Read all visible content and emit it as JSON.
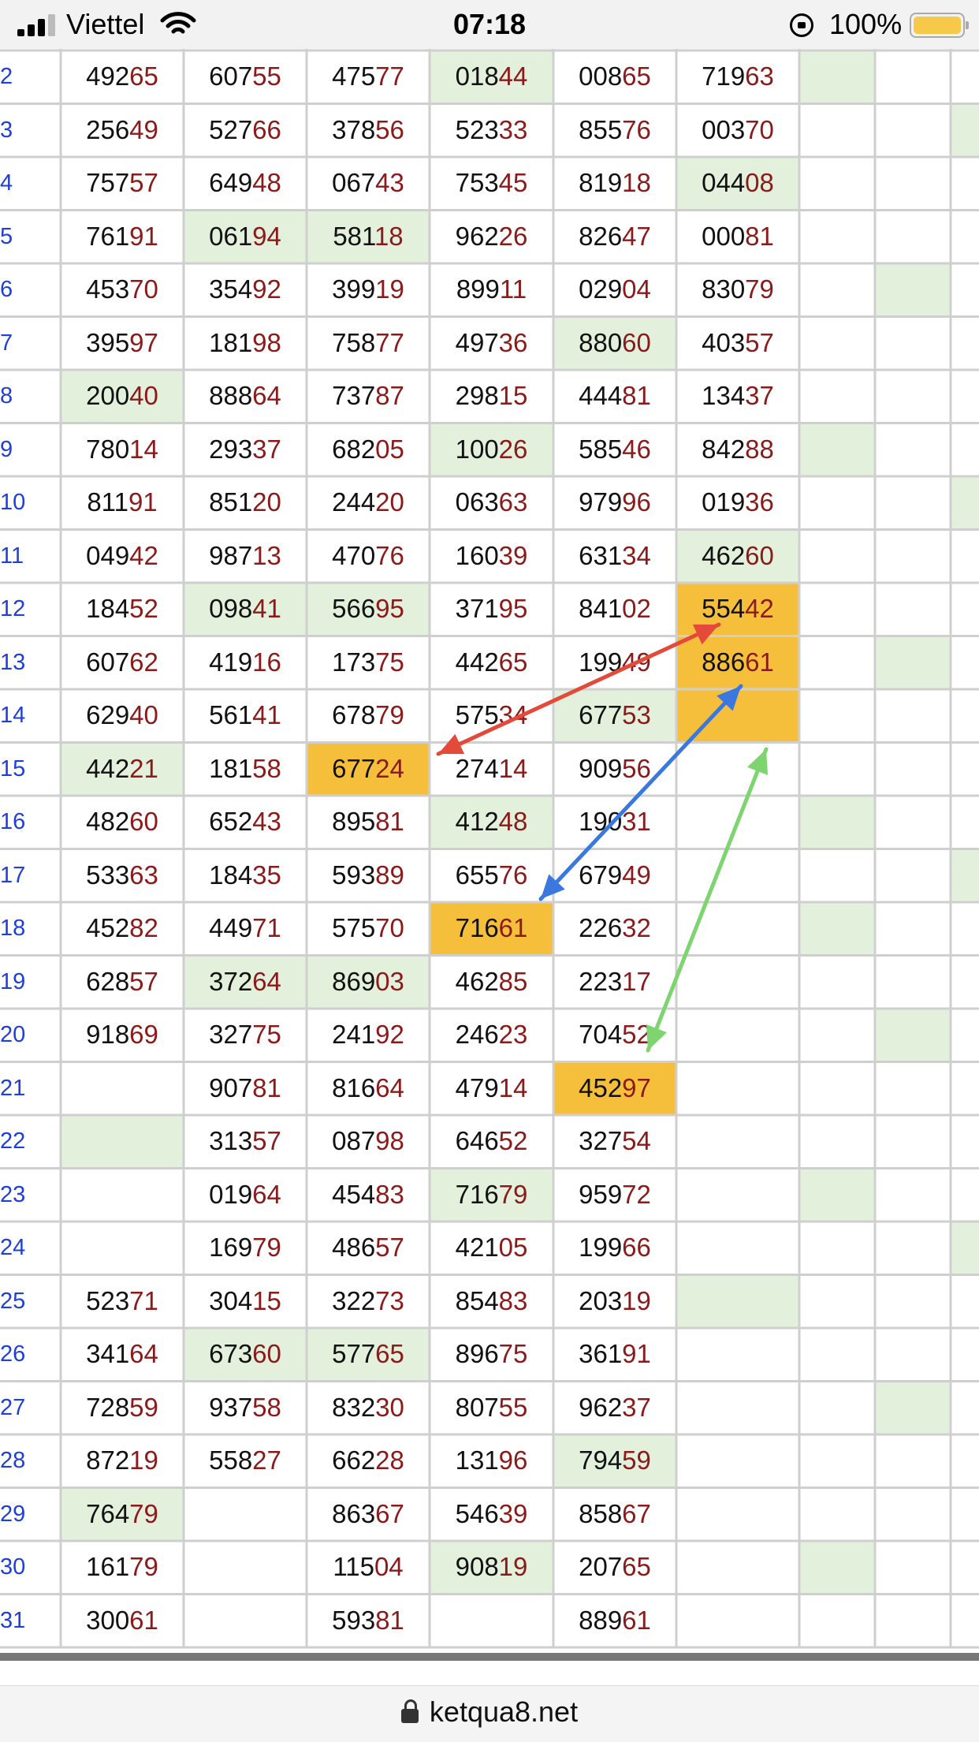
{
  "status_bar": {
    "carrier": "Viettel",
    "time": "07:18",
    "battery": "100%"
  },
  "colors": {
    "highlight": "#f6bf3b",
    "shade": "#e3f0dc",
    "row_label": "#1f3fd6",
    "tail_digits": "#8b1a1a",
    "arrow_red": "#e44a3a",
    "arrow_blue": "#3a78e0",
    "arrow_green": "#7ed46f"
  },
  "address_bar": {
    "domain": "ketqua8.net"
  },
  "table": {
    "rows": [
      {
        "label": "2",
        "values": [
          "49265",
          "60755",
          "47577",
          "01844",
          "00865",
          "71963"
        ]
      },
      {
        "label": "3",
        "values": [
          "25649",
          "52766",
          "37856",
          "52333",
          "85576",
          "00370"
        ]
      },
      {
        "label": "4",
        "values": [
          "75757",
          "64948",
          "06743",
          "75345",
          "81918",
          "04408"
        ]
      },
      {
        "label": "5",
        "values": [
          "76191",
          "06194",
          "58118",
          "96226",
          "82647",
          "00081"
        ]
      },
      {
        "label": "6",
        "values": [
          "45370",
          "35492",
          "39919",
          "89911",
          "02904",
          "83079"
        ]
      },
      {
        "label": "7",
        "values": [
          "39597",
          "18198",
          "75877",
          "49736",
          "88060",
          "40357"
        ]
      },
      {
        "label": "8",
        "values": [
          "20040",
          "88864",
          "73787",
          "29815",
          "44481",
          "13437"
        ]
      },
      {
        "label": "9",
        "values": [
          "78014",
          "29337",
          "68205",
          "10026",
          "58546",
          "84288"
        ]
      },
      {
        "label": "10",
        "values": [
          "81191",
          "85120",
          "24420",
          "06363",
          "97996",
          "01936"
        ]
      },
      {
        "label": "11",
        "values": [
          "04942",
          "98713",
          "47076",
          "16039",
          "63134",
          "46260"
        ]
      },
      {
        "label": "12",
        "values": [
          "18452",
          "09841",
          "56695",
          "37195",
          "84102",
          "55442"
        ]
      },
      {
        "label": "13",
        "values": [
          "60762",
          "41916",
          "17375",
          "44265",
          "19949",
          "88661"
        ]
      },
      {
        "label": "14",
        "values": [
          "62940",
          "56141",
          "67879",
          "57534",
          "67753",
          ""
        ]
      },
      {
        "label": "15",
        "values": [
          "44221",
          "18158",
          "67724",
          "27414",
          "90956",
          ""
        ]
      },
      {
        "label": "16",
        "values": [
          "48260",
          "65243",
          "89581",
          "41248",
          "19031",
          ""
        ]
      },
      {
        "label": "17",
        "values": [
          "53363",
          "18435",
          "59389",
          "65576",
          "67949",
          ""
        ]
      },
      {
        "label": "18",
        "values": [
          "45282",
          "44971",
          "57570",
          "71661",
          "22632",
          ""
        ]
      },
      {
        "label": "19",
        "values": [
          "62857",
          "37264",
          "86903",
          "46285",
          "22317",
          ""
        ]
      },
      {
        "label": "20",
        "values": [
          "91869",
          "32775",
          "24192",
          "24623",
          "70452",
          ""
        ]
      },
      {
        "label": "21",
        "values": [
          "",
          "90781",
          "81664",
          "47914",
          "45297",
          ""
        ]
      },
      {
        "label": "22",
        "values": [
          "",
          "31357",
          "08798",
          "64652",
          "32754",
          ""
        ]
      },
      {
        "label": "23",
        "values": [
          "",
          "01964",
          "45483",
          "71679",
          "95972",
          ""
        ]
      },
      {
        "label": "24",
        "values": [
          "",
          "16979",
          "48657",
          "42105",
          "19966",
          ""
        ]
      },
      {
        "label": "25",
        "values": [
          "52371",
          "30415",
          "32273",
          "85483",
          "20319",
          ""
        ]
      },
      {
        "label": "26",
        "values": [
          "34164",
          "67360",
          "57765",
          "89675",
          "36191",
          ""
        ]
      },
      {
        "label": "27",
        "values": [
          "72859",
          "93758",
          "83230",
          "80755",
          "96237",
          ""
        ]
      },
      {
        "label": "28",
        "values": [
          "87219",
          "55827",
          "66228",
          "13196",
          "79459",
          ""
        ]
      },
      {
        "label": "29",
        "values": [
          "76479",
          "",
          "86367",
          "54639",
          "85867",
          ""
        ]
      },
      {
        "label": "30",
        "values": [
          "16179",
          "",
          "11504",
          "90819",
          "20765",
          ""
        ]
      },
      {
        "label": "31",
        "values": [
          "30061",
          "",
          "59381",
          "",
          "88961",
          ""
        ]
      }
    ],
    "highlighted": [
      [
        10,
        5
      ],
      [
        11,
        5
      ],
      [
        12,
        5
      ],
      [
        13,
        2
      ],
      [
        16,
        3
      ],
      [
        19,
        4
      ]
    ],
    "shaded": [
      [
        0,
        3
      ],
      [
        0,
        6
      ],
      [
        1,
        8
      ],
      [
        2,
        5
      ],
      [
        3,
        1
      ],
      [
        3,
        2
      ],
      [
        4,
        7
      ],
      [
        5,
        4
      ],
      [
        6,
        0
      ],
      [
        7,
        3
      ],
      [
        7,
        6
      ],
      [
        8,
        8
      ],
      [
        9,
        5
      ],
      [
        10,
        1
      ],
      [
        10,
        2
      ],
      [
        11,
        7
      ],
      [
        12,
        4
      ],
      [
        13,
        0
      ],
      [
        14,
        3
      ],
      [
        14,
        6
      ],
      [
        15,
        8
      ],
      [
        16,
        6
      ],
      [
        17,
        1
      ],
      [
        17,
        2
      ],
      [
        18,
        7
      ],
      [
        20,
        0
      ],
      [
        21,
        3
      ],
      [
        21,
        6
      ],
      [
        22,
        8
      ],
      [
        23,
        5
      ],
      [
        24,
        1
      ],
      [
        24,
        2
      ],
      [
        25,
        7
      ],
      [
        26,
        4
      ],
      [
        27,
        0
      ],
      [
        28,
        3
      ],
      [
        28,
        6
      ]
    ]
  }
}
